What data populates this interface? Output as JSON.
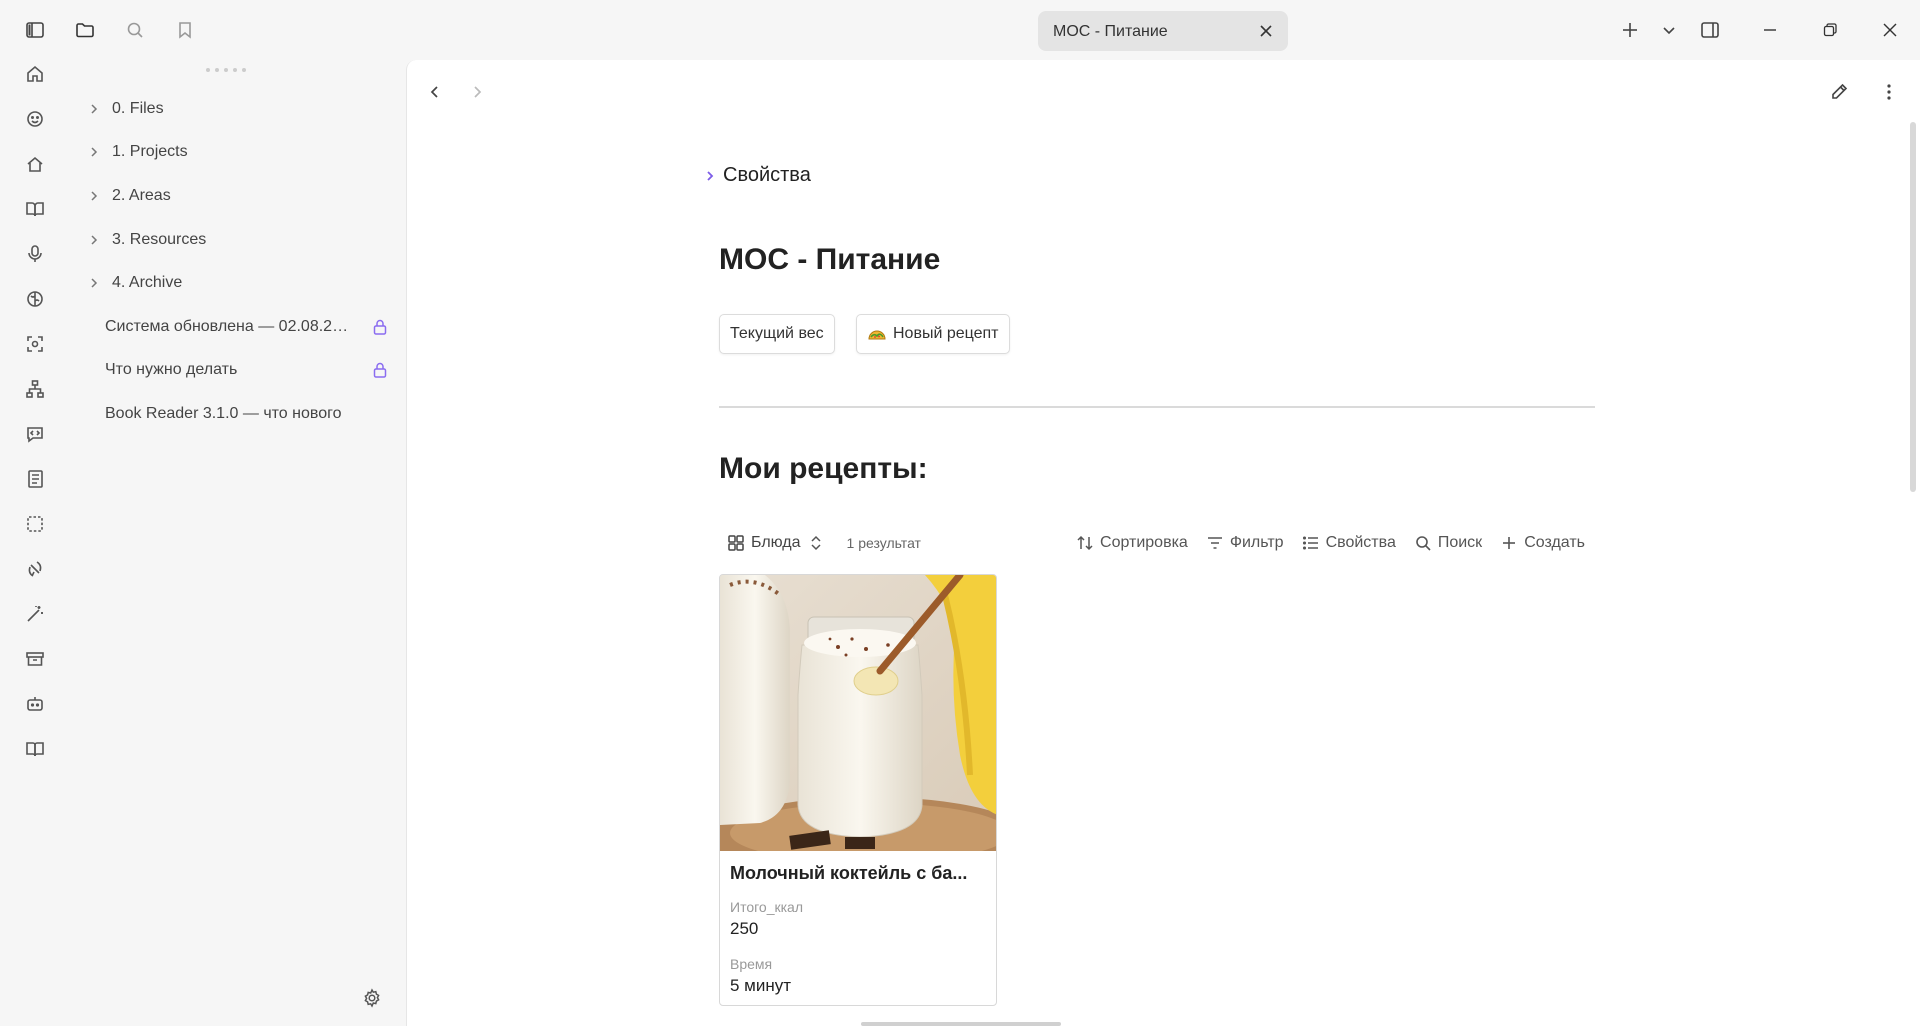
{
  "titlebar": {
    "tab_title": "МОС - Питание"
  },
  "sidebar": {
    "folders": [
      {
        "label": "0. Files"
      },
      {
        "label": "1. Projects"
      },
      {
        "label": "2. Areas"
      },
      {
        "label": "3. Resources"
      },
      {
        "label": "4. Archive"
      }
    ],
    "files": [
      {
        "label": "Система обновлена — 02.08.20...",
        "locked": true
      },
      {
        "label": "Что нужно делать",
        "locked": true
      },
      {
        "label": "Book Reader 3.1.0 — что нового",
        "locked": false
      }
    ]
  },
  "note": {
    "properties_label": "Свойства",
    "title": "МОС - Питание",
    "buttons": {
      "current_weight": "Текущий вес",
      "new_recipe": "Новый рецепт"
    },
    "section_title": "Мои рецепты:",
    "base": {
      "view_name": "Блюда",
      "result_count": "1 результат",
      "tools": {
        "sort": "Сортировка",
        "filter": "Фильтр",
        "properties": "Свойства",
        "search": "Поиск",
        "create": "Создать"
      },
      "cards": [
        {
          "title": "Молочный коктейль с ба...",
          "props": [
            {
              "name": "Итого_ккал",
              "value": "250"
            },
            {
              "name": "Время",
              "value": "5 минут"
            }
          ]
        }
      ]
    }
  },
  "colors": {
    "accent": "#7c5ce8",
    "lock": "#8a6cf0"
  }
}
